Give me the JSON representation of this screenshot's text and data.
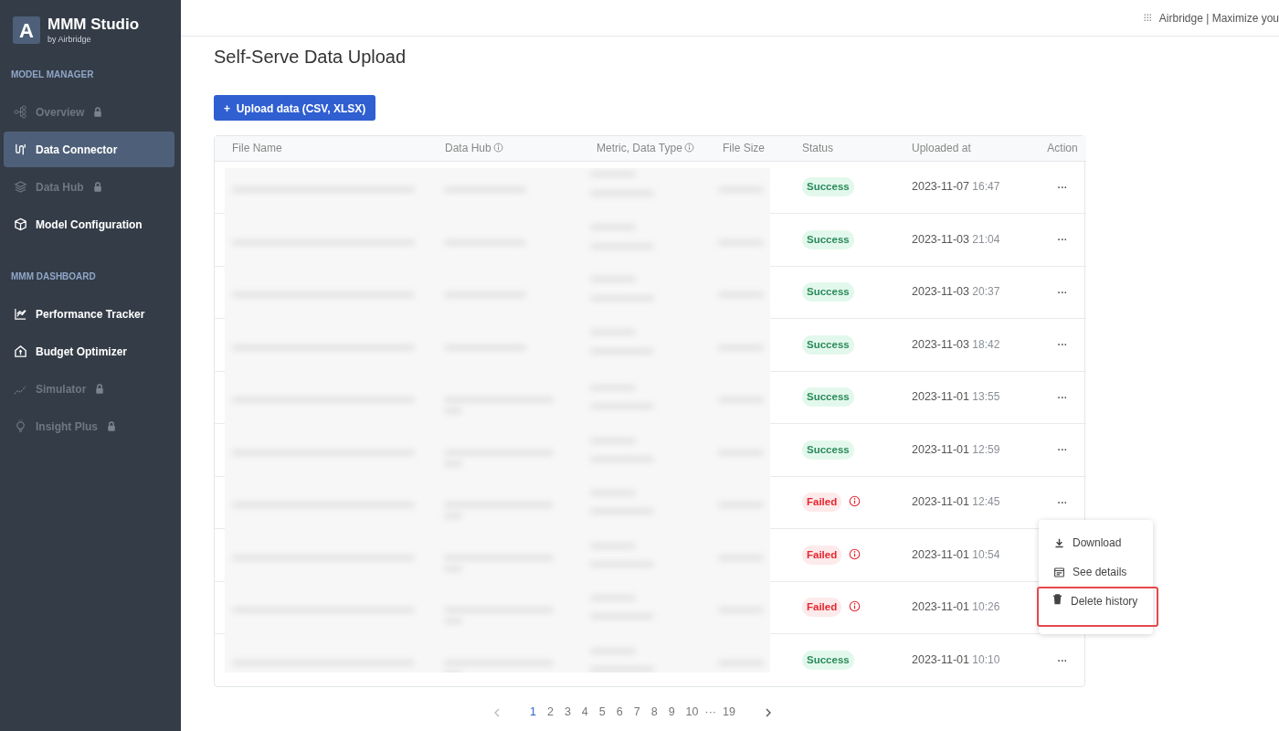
{
  "brand": {
    "logo_letter": "A",
    "title": "MMM Studio",
    "subtitle": "by Airbridge"
  },
  "sidebar": {
    "sections": [
      {
        "heading": "MODEL MANAGER",
        "items": [
          {
            "label": "Overview",
            "locked": true,
            "selected": false
          },
          {
            "label": "Data Connector",
            "locked": false,
            "selected": true
          },
          {
            "label": "Data Hub",
            "locked": true,
            "selected": false
          },
          {
            "label": "Model Configuration",
            "locked": false,
            "selected": false
          }
        ]
      },
      {
        "heading": "MMM DASHBOARD",
        "items": [
          {
            "label": "Performance Tracker",
            "locked": false,
            "selected": false
          },
          {
            "label": "Budget Optimizer",
            "locked": false,
            "selected": false
          },
          {
            "label": "Simulator",
            "locked": true,
            "selected": false
          },
          {
            "label": "Insight Plus",
            "locked": true,
            "selected": false
          }
        ]
      }
    ]
  },
  "topbar": {
    "text": "Airbridge | Maximize you"
  },
  "page": {
    "title": "Self-Serve Data Upload",
    "upload_button": {
      "icon": "+",
      "label": "Upload data (CSV, XLSX)"
    }
  },
  "table": {
    "columns": [
      {
        "label": "File Name"
      },
      {
        "label": "Data Hub",
        "info": true
      },
      {
        "label": "Metric, Data Type",
        "info": true
      },
      {
        "label": "File Size"
      },
      {
        "label": "Status"
      },
      {
        "label": "Uploaded at"
      },
      {
        "label": "Action"
      }
    ],
    "rows": [
      {
        "status": "Success",
        "kind": "success",
        "date": "2023-11-07",
        "time": "16:47",
        "action": "···"
      },
      {
        "status": "Success",
        "kind": "success",
        "date": "2023-11-03",
        "time": "21:04",
        "action": "···"
      },
      {
        "status": "Success",
        "kind": "success",
        "date": "2023-11-03",
        "time": "20:37",
        "action": "···"
      },
      {
        "status": "Success",
        "kind": "success",
        "date": "2023-11-03",
        "time": "18:42",
        "action": "···"
      },
      {
        "status": "Success",
        "kind": "success",
        "date": "2023-11-01",
        "time": "13:55",
        "action": "···"
      },
      {
        "status": "Success",
        "kind": "success",
        "date": "2023-11-01",
        "time": "12:59",
        "action": "···"
      },
      {
        "status": "Failed",
        "kind": "failed",
        "date": "2023-11-01",
        "time": "12:45",
        "action": "···"
      },
      {
        "status": "Failed",
        "kind": "failed",
        "date": "2023-11-01",
        "time": "10:54"
      },
      {
        "status": "Failed",
        "kind": "failed",
        "date": "2023-11-01",
        "time": "10:26"
      },
      {
        "status": "Success",
        "kind": "success",
        "date": "2023-11-01",
        "time": "10:10",
        "action": "···"
      }
    ]
  },
  "action_menu": {
    "items": [
      {
        "label": "Download",
        "highlighted": false
      },
      {
        "label": "See details",
        "highlighted": false
      },
      {
        "label": "Delete history",
        "highlighted": true
      }
    ]
  },
  "pagination": {
    "pages": [
      {
        "label": "1",
        "selected": true
      },
      {
        "label": "2",
        "selected": false
      },
      {
        "label": "3",
        "selected": false
      },
      {
        "label": "4",
        "selected": false
      },
      {
        "label": "5",
        "selected": false
      },
      {
        "label": "6",
        "selected": false
      },
      {
        "label": "7",
        "selected": false
      },
      {
        "label": "8",
        "selected": false
      },
      {
        "label": "9",
        "selected": false
      },
      {
        "label": "10",
        "selected": false
      },
      {
        "label": "···",
        "selected": false
      },
      {
        "label": "19",
        "selected": false
      }
    ]
  }
}
